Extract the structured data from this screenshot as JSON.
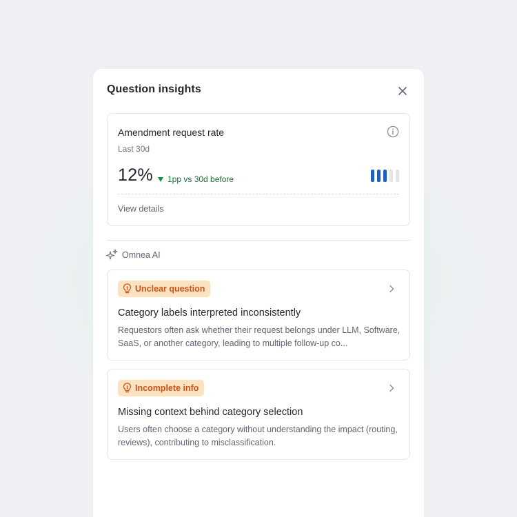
{
  "panel": {
    "title": "Question insights",
    "close_icon": "close-icon"
  },
  "metric": {
    "title": "Amendment request rate",
    "info_icon": "info-icon",
    "period": "Last 30d",
    "value": "12%",
    "delta_text": "1pp vs 30d before",
    "delta_direction": "down",
    "delta_color": "#1f8a4c",
    "level": {
      "filled": 3,
      "total": 5
    },
    "bar_color": "#1e5fc4",
    "view_details_label": "View details"
  },
  "ai": {
    "label": "Omnea AI",
    "icon": "sparkles-icon"
  },
  "insights": [
    {
      "badge": "Unclear question",
      "badge_icon": "lightbulb-icon",
      "title": "Category labels interpreted inconsistently",
      "description": "Requestors often ask whether their request belongs under LLM, Software, SaaS, or another category, leading to multiple follow-up co..."
    },
    {
      "badge": "Incomplete info",
      "badge_icon": "lightbulb-icon",
      "title": "Missing context behind category selection",
      "description": "Users often choose a category without understanding the impact (routing, reviews), contributing to misclassification."
    }
  ],
  "colors": {
    "badge_bg": "#fde2bf",
    "badge_text": "#c7541a",
    "background": "#eef0f3",
    "panel": "#ffffff"
  }
}
